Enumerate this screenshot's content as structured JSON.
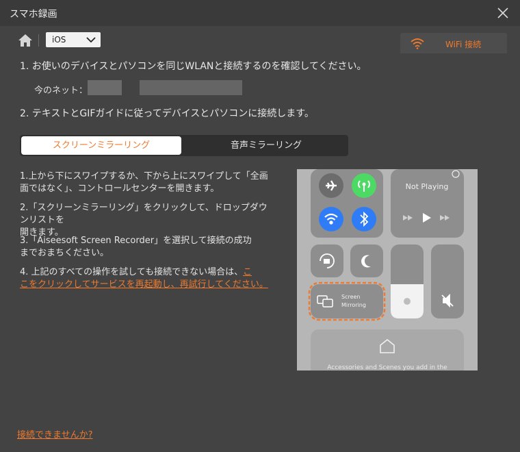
{
  "window": {
    "title": "スマホ録画"
  },
  "nav": {
    "device_select": "iOS",
    "wifi_tab": "WiFi 接続"
  },
  "steps": {
    "step1": "1. お使いのデバイスとパソコンを同じWLANと接続するのを確認してください。",
    "network_label": "今のネット：",
    "step2": "2. テキストとGIFガイドに従ってデバイスとパソコンに接続します。"
  },
  "tabs": {
    "screen": "スクリーンミラーリング",
    "audio": "音声ミラーリング"
  },
  "instructions": {
    "i1a": "1.上から下にスワイプするか、下から上にスワイプして「全画",
    "i1b": "面ではなく」、コントロールセンターを開きます。",
    "i2a": "2.「スクリーンミラーリング」をクリックして、ドロップダウンリストを",
    "i2b": "開きます。",
    "i3a": "3.「Aiseesoft Screen Recorder」を選択して接続の成功",
    "i3b": "までおまちください。",
    "i4a": "4. 上記のすべての操作を試しても接続できない場合は、",
    "i4link_a": "こ",
    "i4link_b": "こをクリックしてサービスを再起動し、再試行してください。"
  },
  "phone": {
    "not_playing": "Not Playing",
    "screen_label": "Screen",
    "mirroring_label": "Mirroring",
    "accessories": "Accessories and Scenes you add in the"
  },
  "footer": {
    "help_link": "接続できませんか?"
  },
  "colors": {
    "accent": "#ef7a2e",
    "bg": "#434343",
    "titlebar": "#3a3a3a"
  }
}
